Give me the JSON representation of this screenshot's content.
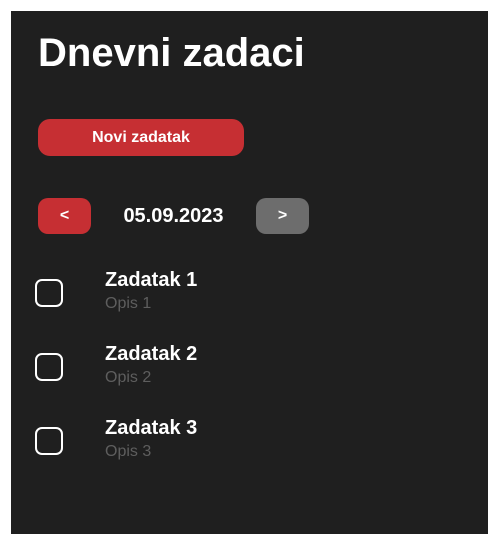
{
  "header": {
    "title": "Dnevni zadaci"
  },
  "toolbar": {
    "new_task_label": "Novi zadatak"
  },
  "date_nav": {
    "prev_label": "<",
    "date": "05.09.2023",
    "next_label": ">"
  },
  "tasks": [
    {
      "name": "Zadatak 1",
      "description": "Opis 1",
      "done": false
    },
    {
      "name": "Zadatak 2",
      "description": "Opis 2",
      "done": false
    },
    {
      "name": "Zadatak 3",
      "description": "Opis 3",
      "done": false
    }
  ],
  "colors": {
    "background": "#1f1f1f",
    "accent": "#c62f33",
    "secondary_button": "#6d6d6d",
    "muted_text": "#5e5e5e"
  }
}
